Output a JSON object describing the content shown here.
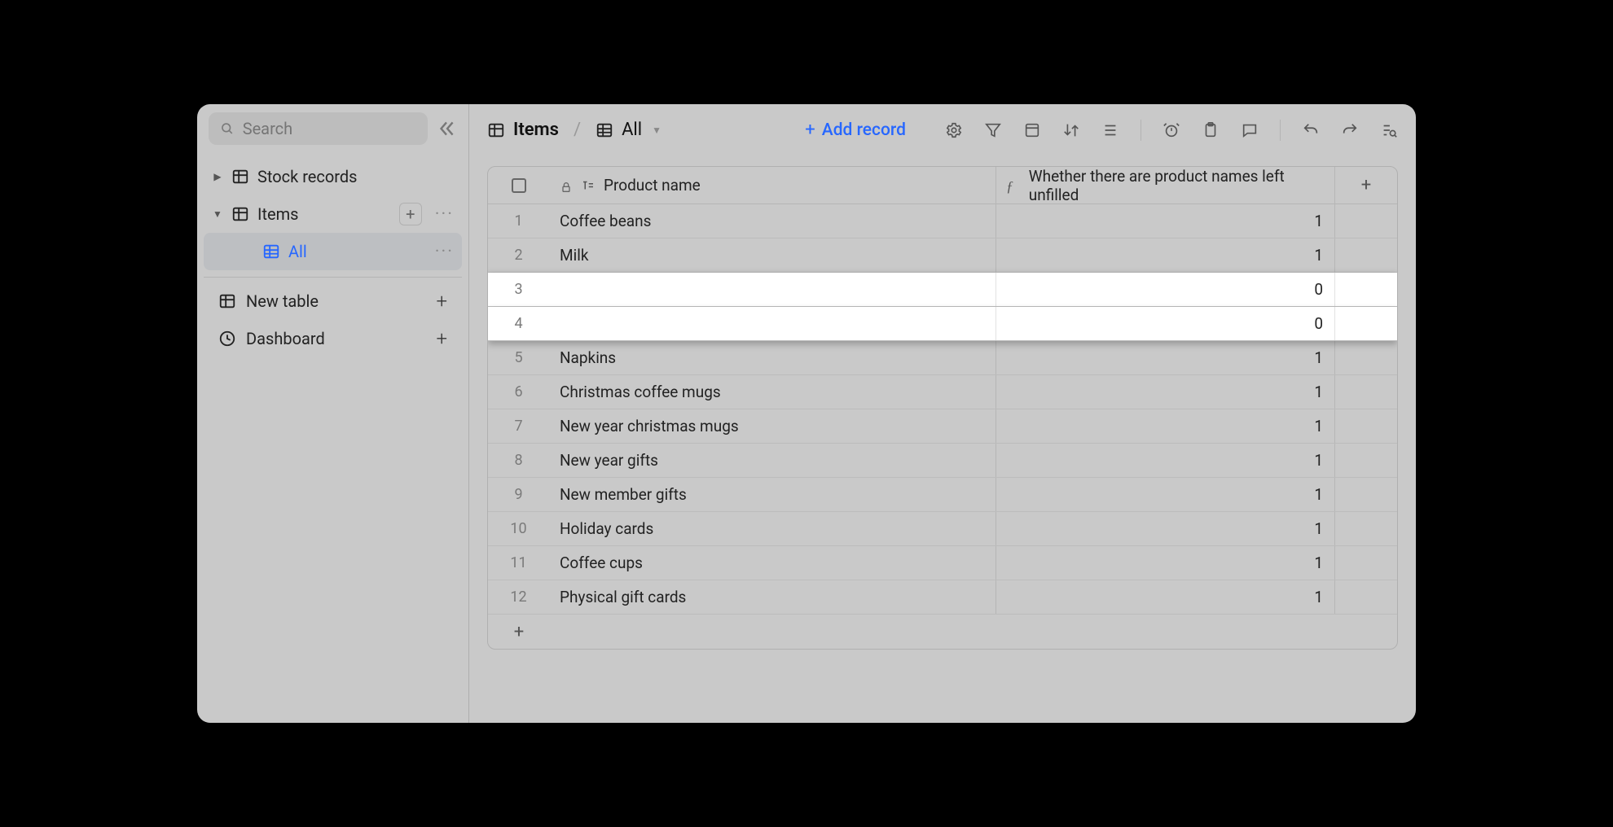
{
  "sidebar": {
    "search_placeholder": "Search",
    "tables": [
      {
        "label": "Stock records",
        "expanded": false
      },
      {
        "label": "Items",
        "expanded": true
      }
    ],
    "active_view": "All",
    "new_table_label": "New table",
    "dashboard_label": "Dashboard"
  },
  "breadcrumb": {
    "table": "Items",
    "view": "All"
  },
  "add_record_label": "Add record",
  "columns": {
    "product_name": "Product name",
    "unfilled_flag": "Whether there are product names left unfilled"
  },
  "rows": [
    {
      "n": 1,
      "name": "Coffee beans",
      "val": "1",
      "hl": false
    },
    {
      "n": 2,
      "name": "Milk",
      "val": "1",
      "hl": false
    },
    {
      "n": 3,
      "name": "",
      "val": "0",
      "hl": true
    },
    {
      "n": 4,
      "name": "",
      "val": "0",
      "hl": true
    },
    {
      "n": 5,
      "name": "Napkins",
      "val": "1",
      "hl": false
    },
    {
      "n": 6,
      "name": "Christmas coffee mugs",
      "val": "1",
      "hl": false
    },
    {
      "n": 7,
      "name": "New year christmas mugs",
      "val": "1",
      "hl": false
    },
    {
      "n": 8,
      "name": "New year gifts",
      "val": "1",
      "hl": false
    },
    {
      "n": 9,
      "name": "New member gifts",
      "val": "1",
      "hl": false
    },
    {
      "n": 10,
      "name": "Holiday cards",
      "val": "1",
      "hl": false
    },
    {
      "n": 11,
      "name": "Coffee cups",
      "val": "1",
      "hl": false
    },
    {
      "n": 12,
      "name": "Physical gift cards",
      "val": "1",
      "hl": false
    }
  ]
}
